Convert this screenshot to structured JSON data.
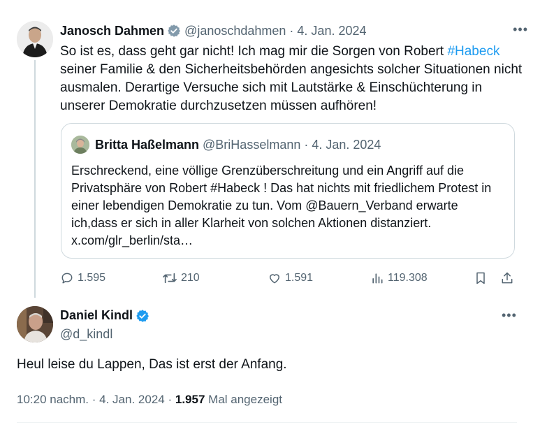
{
  "thread_tweet": {
    "author_name": "Janosch Dahmen",
    "author_handle": "@janoschdahmen",
    "separator": "·",
    "date": "4. Jan. 2024",
    "more_label": "•••",
    "text_before_hashtag": "So ist es, dass geht gar nicht! Ich mag mir die Sorgen von Robert ",
    "hashtag": "#Habeck",
    "text_after_hashtag": " seiner Familie & den Sicherheitsbehörden angesichts solcher Situationen nicht ausmalen. Derartige Versuche sich mit Lautstärke & Einschüchterung in unserer Demokratie durchzusetzen müssen aufhören!",
    "quote": {
      "author_name": "Britta Haßelmann",
      "author_handle": "@BriHasselmann",
      "separator": "·",
      "date": "4. Jan. 2024",
      "text": "Erschreckend, eine völlige Grenzüberschreitung und ein Angriff auf die Privatsphäre von Robert #Habeck ! Das hat nichts mit friedlichem Protest in einer lebendigen Demokratie zu tun. Vom @Bauern_Verband erwarte ich,dass er sich in aller Klarheit von solchen Aktionen distanziert. x.com/glr_berlin/sta…"
    },
    "actions": {
      "replies": "1.595",
      "reposts": "210",
      "likes": "1.591",
      "views": "119.308"
    }
  },
  "main_tweet": {
    "author_name": "Daniel Kindl",
    "author_handle": "@d_kindl",
    "more_label": "•••",
    "text": "Heul leise du Lappen, Das ist erst der Anfang.",
    "time": "10:20 nachm.",
    "separator": "·",
    "date": "4. Jan. 2024",
    "separator2": "·",
    "view_count": "1.957",
    "view_label": "Mal angezeigt"
  },
  "colors": {
    "accent": "#1d9bf0",
    "muted": "#536471",
    "border": "#cfd9de",
    "verified": "#1d9bf0"
  },
  "icons": [
    "verified-badge-icon",
    "more-icon",
    "reply-icon",
    "repost-icon",
    "like-icon",
    "views-icon",
    "bookmark-icon",
    "share-icon"
  ]
}
